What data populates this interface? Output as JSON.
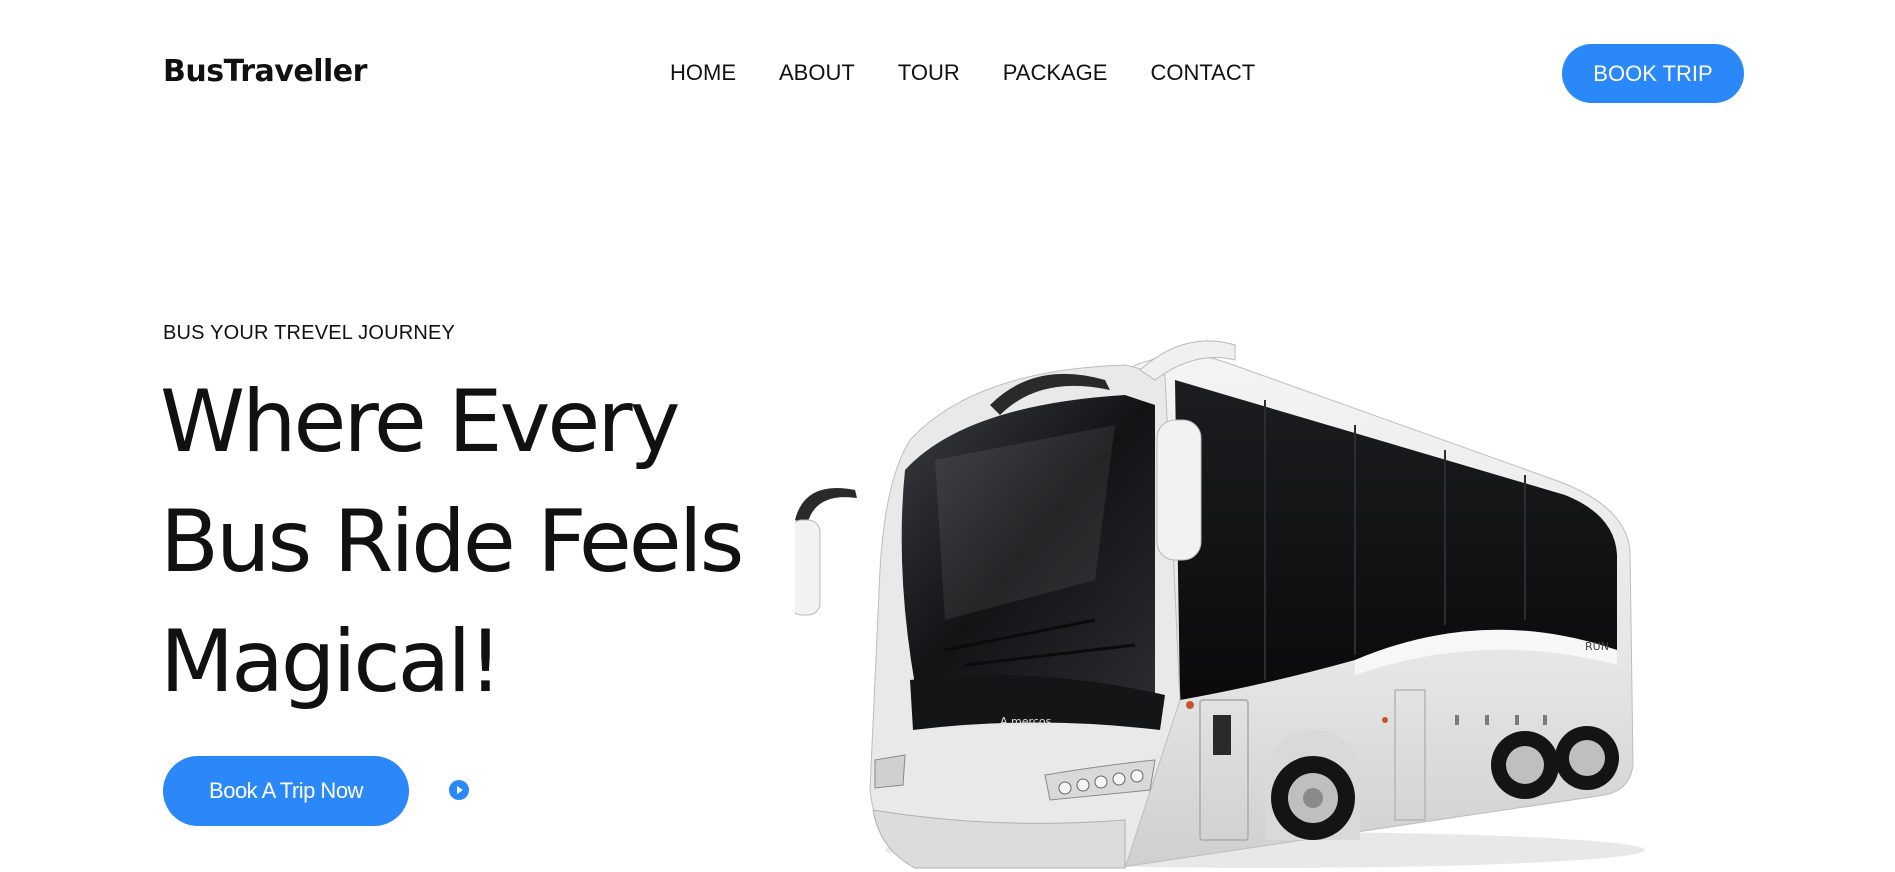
{
  "header": {
    "logo": "BusTraveller",
    "nav": [
      "HOME",
      "ABOUT",
      "TOUR",
      "PACKAGE",
      "CONTACT"
    ],
    "book_button": "BOOK TRIP"
  },
  "hero": {
    "eyebrow": "BUS YOUR TREVEL JOURNEY",
    "headline": [
      "Where Every",
      "Bus Ride Feels",
      "Magical!"
    ],
    "cta": "Book A Trip Now",
    "bus_brand": "A mercos",
    "bus_side_text": "RUN"
  },
  "colors": {
    "accent": "#2b88f8",
    "text": "#111111",
    "background": "#ffffff"
  },
  "icons": {
    "play": "play-icon"
  }
}
